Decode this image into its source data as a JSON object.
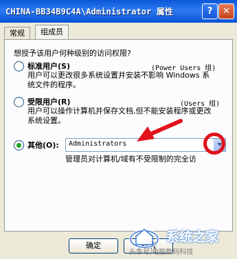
{
  "window": {
    "title": "CHINA-BB34B9C4A\\Administrator 属性",
    "help_glyph": "?",
    "close_glyph": "✕"
  },
  "tabs": [
    {
      "label": "常规",
      "active": false
    },
    {
      "label": "组成员",
      "active": true
    }
  ],
  "question": "想授予该用户何种级别的访问权限?",
  "options": [
    {
      "label": "标准用户(S)",
      "group": "(Power Users 组)",
      "desc": "用户可以更改很多系统设置并安装不影响 Windows 系统文件的程序。",
      "selected": false
    },
    {
      "label": "受限用户(R)",
      "group": "(Users 组)",
      "desc": "用户可以操作计算机并保存文档,但不能安装程序或更改系统设置。",
      "selected": false
    },
    {
      "label": "其他(O):",
      "selected": true
    }
  ],
  "other_combo": {
    "value": "Administrators"
  },
  "other_desc": "管理员对计算机/域有不受限制的完全访",
  "buttons": {
    "ok": "确定",
    "cancel": "取消"
  },
  "watermark": {
    "brand": "系统之家",
    "caption": "头条号/电脑数码科技"
  },
  "annotation_color": "#e1121b"
}
